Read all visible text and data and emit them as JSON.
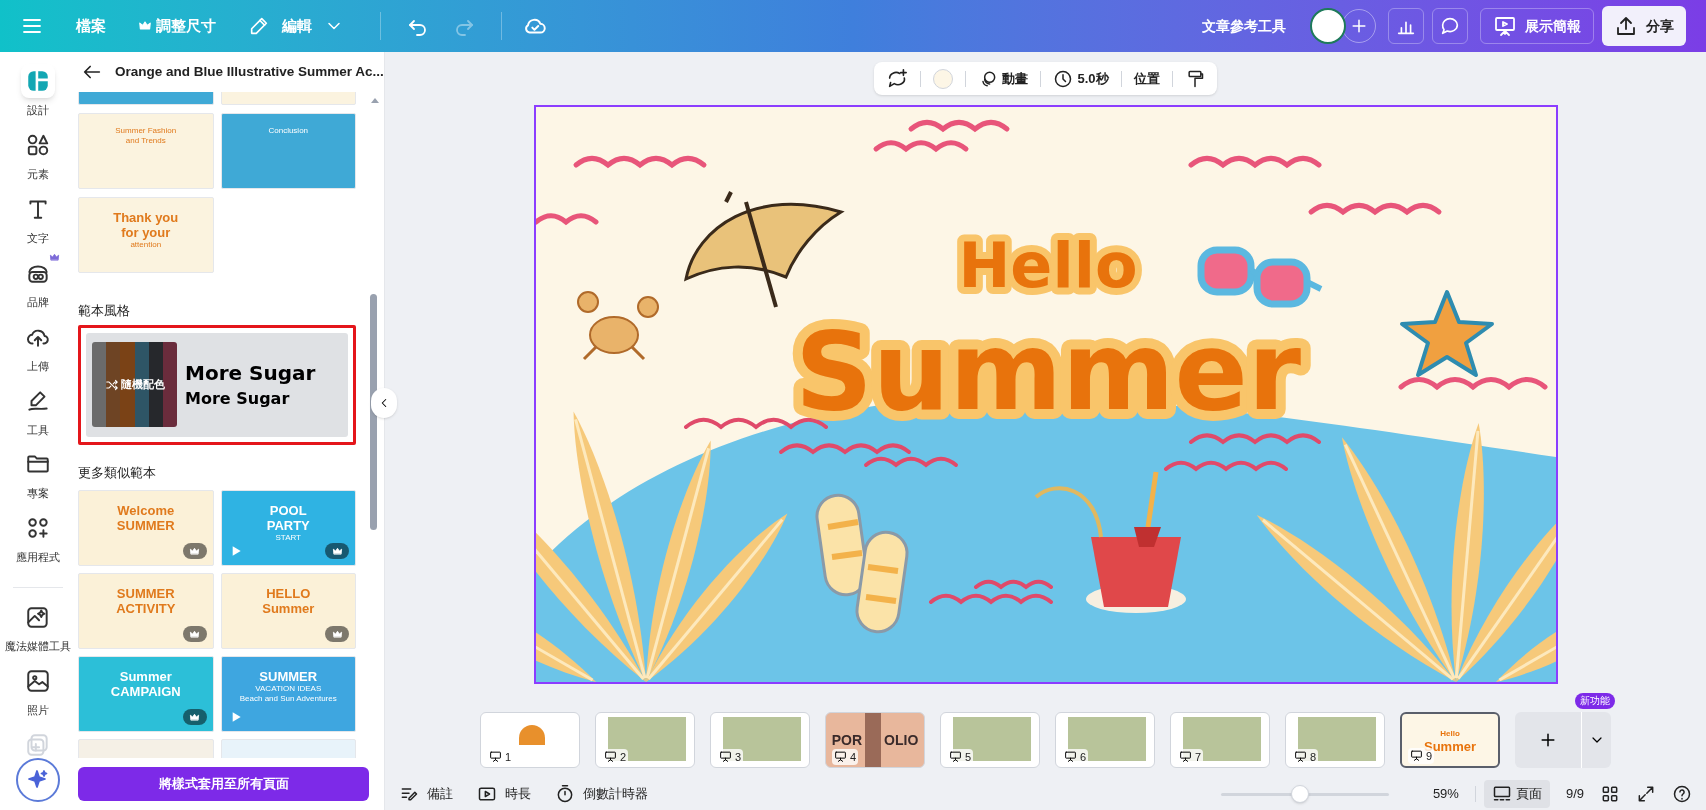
{
  "top_bar": {
    "menu": [
      {
        "label": "檔案"
      },
      {
        "label": "調整尺寸"
      },
      {
        "label": "編輯"
      }
    ],
    "tool_label": "文章參考工具",
    "present_button": "展示簡報",
    "share_button": "分享"
  },
  "rail": [
    {
      "label": "設計",
      "selected": true
    },
    {
      "label": "元素",
      "selected": false
    },
    {
      "label": "文字",
      "selected": false
    },
    {
      "label": "品牌",
      "selected": false
    },
    {
      "label": "上傳",
      "selected": false
    },
    {
      "label": "工具",
      "selected": false
    },
    {
      "label": "專案",
      "selected": false
    },
    {
      "label": "應用程式",
      "selected": false
    },
    {
      "label": "魔法媒體工具",
      "selected": false
    },
    {
      "label": "照片",
      "selected": false
    }
  ],
  "panel": {
    "title": "Orange and Blue Illustrative Summer Ac...",
    "template_pages": [
      {
        "color": "#3fa9d6",
        "cropped": true
      },
      {
        "color": "#fbf3df",
        "cropped": true
      },
      {
        "color": "#fbf3df",
        "lines": [
          "Summer Fashion",
          "and Trends"
        ]
      },
      {
        "color": "#3fa9d6",
        "lines": [
          "Conclusion"
        ]
      },
      {
        "color": "#fbf3df",
        "lines": [
          "Thank you",
          "for your",
          "attention"
        ]
      }
    ],
    "style_heading": "範本風格",
    "style_card": {
      "highlighted": true,
      "shuffle_label": "隨機配色",
      "heading_font": "More Sugar",
      "body_font": "More Sugar",
      "palette": [
        {
          "color": "#6b6b6b"
        },
        {
          "color": "#6e4424"
        },
        {
          "color": "#7a4216"
        },
        {
          "color": "#2e5566"
        },
        {
          "color": "#26282c"
        },
        {
          "color": "#6a2c3c"
        }
      ]
    },
    "similar_heading": "更多類似範本",
    "similar_templates": [
      {
        "color": "#fbf1d8",
        "lines": [
          "Welcome",
          "SUMMER"
        ],
        "premium": true,
        "video": false
      },
      {
        "color": "#2fb3e3",
        "lines": [
          "POOL",
          "PARTY",
          "START"
        ],
        "premium": true,
        "video": true
      },
      {
        "color": "#fbf1d8",
        "lines": [
          "SUMMER",
          "ACTIVITY"
        ],
        "premium": true,
        "video": false
      },
      {
        "color": "#fbf1d8",
        "lines": [
          "HELLO",
          "Summer"
        ],
        "premium": true,
        "video": false
      },
      {
        "color": "#2cbfd8",
        "lines": [
          "Summer",
          "CAMPAIGN"
        ],
        "premium": true,
        "video": false
      },
      {
        "color": "#3ea6e0",
        "lines": [
          "SUMMER",
          "VACATION IDEAS",
          "Beach and Sun Adventures"
        ],
        "premium": false,
        "video": true
      },
      {
        "color": "#f5f0e6",
        "cropped": true
      },
      {
        "color": "#e8f3fa",
        "cropped": true
      }
    ],
    "apply_button": "將樣式套用至所有頁面"
  },
  "toolbar": {
    "swatch": {
      "color": "#fdf6e6"
    },
    "animate": "動畫",
    "duration": "5.0秒",
    "position": "位置"
  },
  "slide": {
    "selected": true,
    "title": "Hello",
    "subtitle": "Summer"
  },
  "pages": [
    {
      "number": "1",
      "kind": "icon",
      "selected": false
    },
    {
      "number": "2",
      "kind": "photo",
      "selected": false
    },
    {
      "number": "3",
      "kind": "photo",
      "selected": false
    },
    {
      "number": "4",
      "kind": "portfolio",
      "lines": [
        "POR",
        "OLIO"
      ],
      "selected": false
    },
    {
      "number": "5",
      "kind": "photo",
      "selected": false
    },
    {
      "number": "6",
      "kind": "photo",
      "selected": false
    },
    {
      "number": "7",
      "kind": "photo",
      "selected": false
    },
    {
      "number": "8",
      "kind": "photo",
      "selected": false
    },
    {
      "number": "9",
      "kind": "slide",
      "lines": [
        "Hello",
        "Summer"
      ],
      "selected": true
    }
  ],
  "new_badge": "新功能",
  "bottom_bar": {
    "notes": "備註",
    "duration": "時長",
    "timer": "倒數計時器",
    "zoom": {
      "level": 0.47
    },
    "zoom_reading": "59%",
    "pages_button": {
      "label": "頁面",
      "selected": true
    },
    "page_count": "9/9"
  }
}
